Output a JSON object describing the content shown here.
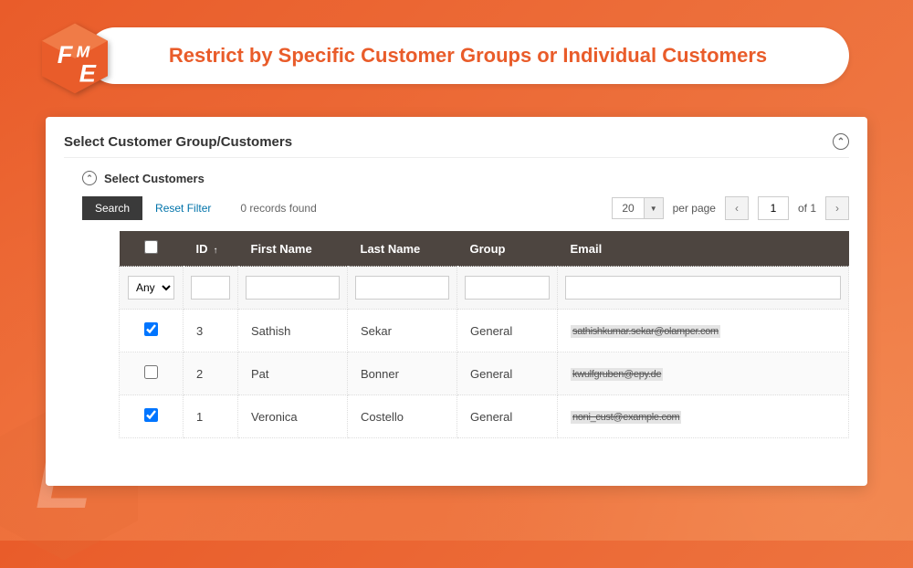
{
  "header": {
    "title": "Restrict by Specific Customer Groups or Individual Customers"
  },
  "panel": {
    "title": "Select Customer Group/Customers",
    "subTitle": "Select Customers"
  },
  "toolbar": {
    "search": "Search",
    "reset": "Reset Filter",
    "records": "0 records found"
  },
  "pager": {
    "perPage": "20",
    "perPageLabel": "per page",
    "currentPage": "1",
    "ofLabel": "of 1"
  },
  "grid": {
    "headers": {
      "id": "ID",
      "firstName": "First Name",
      "lastName": "Last Name",
      "group": "Group",
      "email": "Email"
    },
    "filterAny": "Any",
    "rows": [
      {
        "checked": true,
        "id": "3",
        "firstName": "Sathish",
        "lastName": "Sekar",
        "group": "General",
        "email": "sathishkumar.sekar@olamper.com"
      },
      {
        "checked": false,
        "id": "2",
        "firstName": "Pat",
        "lastName": "Bonner",
        "group": "General",
        "email": "kwulfgruben@epy.de"
      },
      {
        "checked": true,
        "id": "1",
        "firstName": "Veronica",
        "lastName": "Costello",
        "group": "General",
        "email": "noni_cust@example.com"
      }
    ]
  }
}
